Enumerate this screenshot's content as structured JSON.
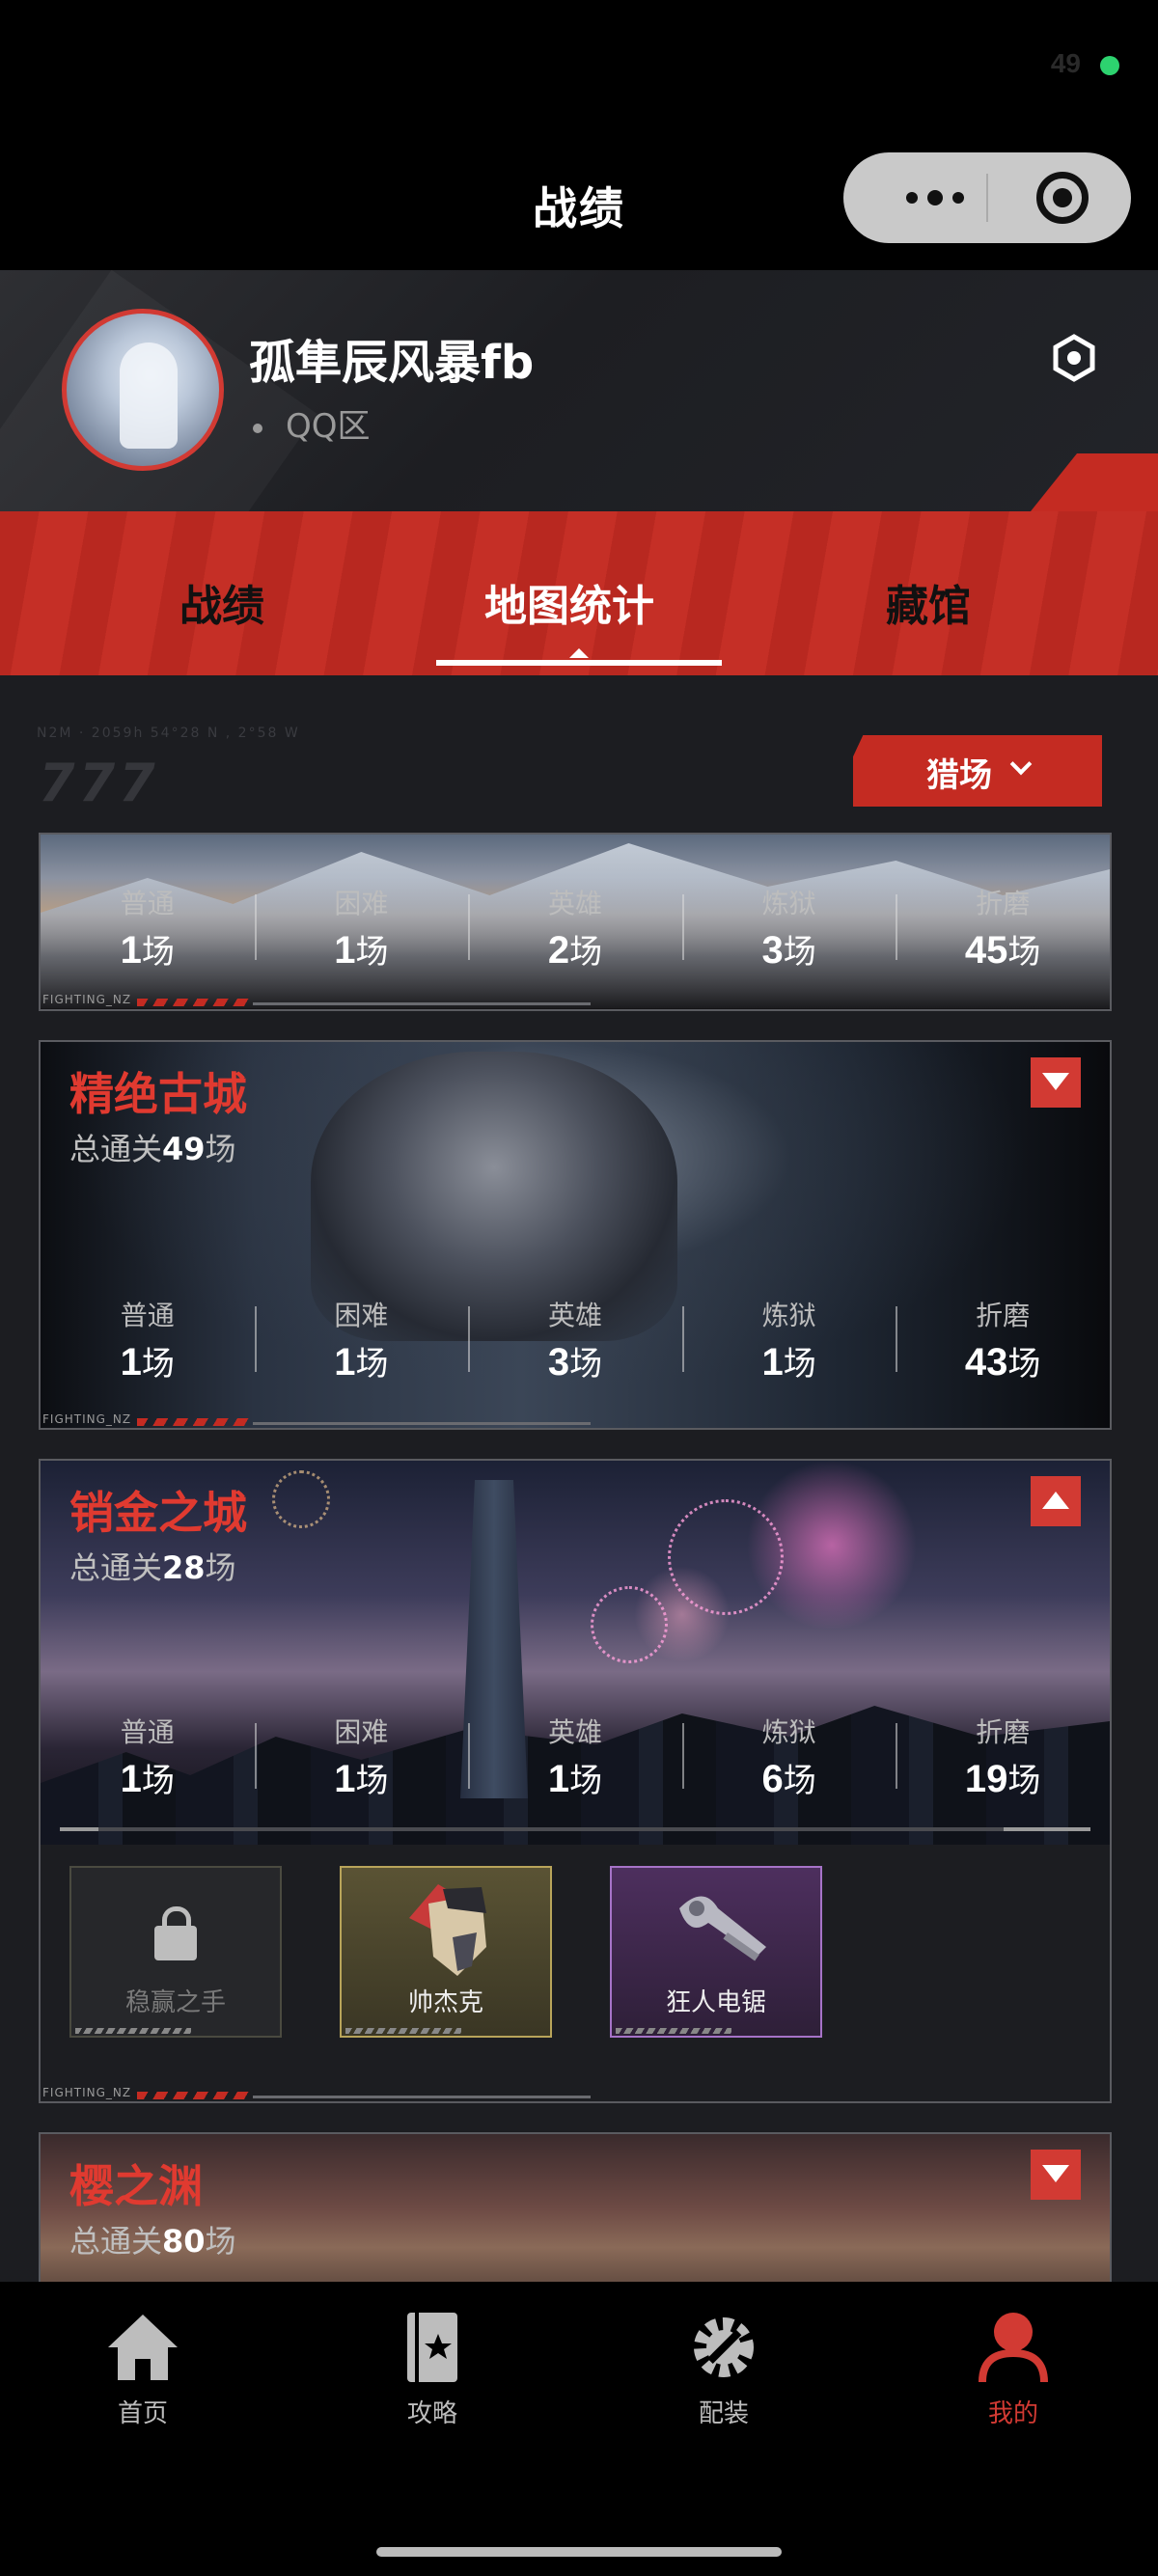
{
  "status": {
    "battery": "49"
  },
  "nav": {
    "title": "战绩"
  },
  "profile": {
    "username": "孤隼辰风暴fb",
    "zone": "QQ区"
  },
  "tabs": [
    {
      "label": "战绩",
      "active": false
    },
    {
      "label": "地图统计",
      "active": true
    },
    {
      "label": "藏馆",
      "active": false
    }
  ],
  "filter": {
    "mode": "猎场"
  },
  "deco": {
    "coords": "N2M · 2059h 54°28 N , 2°58 W",
    "sevens": "777"
  },
  "maps": [
    {
      "name": "",
      "total_prefix": "",
      "total": "",
      "total_suffix": "",
      "expanded": false,
      "stats": [
        {
          "label": "普通",
          "value": "1",
          "unit": "场"
        },
        {
          "label": "困难",
          "value": "1",
          "unit": "场"
        },
        {
          "label": "英雄",
          "value": "2",
          "unit": "场"
        },
        {
          "label": "炼狱",
          "value": "3",
          "unit": "场"
        },
        {
          "label": "折磨",
          "value": "45",
          "unit": "场"
        }
      ]
    },
    {
      "name": "精绝古城",
      "total_prefix": "总通关",
      "total": "49",
      "total_suffix": "场",
      "expanded": false,
      "stats": [
        {
          "label": "普通",
          "value": "1",
          "unit": "场"
        },
        {
          "label": "困难",
          "value": "1",
          "unit": "场"
        },
        {
          "label": "英雄",
          "value": "3",
          "unit": "场"
        },
        {
          "label": "炼狱",
          "value": "1",
          "unit": "场"
        },
        {
          "label": "折磨",
          "value": "43",
          "unit": "场"
        }
      ]
    },
    {
      "name": "销金之城",
      "total_prefix": "总通关",
      "total": "28",
      "total_suffix": "场",
      "expanded": true,
      "stats": [
        {
          "label": "普通",
          "value": "1",
          "unit": "场"
        },
        {
          "label": "困难",
          "value": "1",
          "unit": "场"
        },
        {
          "label": "英雄",
          "value": "1",
          "unit": "场"
        },
        {
          "label": "炼狱",
          "value": "6",
          "unit": "场"
        },
        {
          "label": "折磨",
          "value": "19",
          "unit": "场"
        }
      ],
      "items": [
        {
          "label": "稳赢之手",
          "locked": true
        },
        {
          "label": "帅杰克",
          "locked": false
        },
        {
          "label": "狂人电锯",
          "locked": false
        }
      ]
    },
    {
      "name": "樱之渊",
      "total_prefix": "总通关",
      "total": "80",
      "total_suffix": "场",
      "expanded": false
    }
  ],
  "card_tag": "FIGHTING_NZ",
  "bottom_nav": [
    {
      "label": "首页",
      "icon": "home-icon",
      "active": false
    },
    {
      "label": "攻略",
      "icon": "guide-book-icon",
      "active": false
    },
    {
      "label": "配装",
      "icon": "gear-icon",
      "active": false
    },
    {
      "label": "我的",
      "icon": "user-icon",
      "active": true
    }
  ],
  "colors": {
    "accent": "#c42b22",
    "title_red": "#e03a30",
    "active_tab": "#d23a33"
  }
}
